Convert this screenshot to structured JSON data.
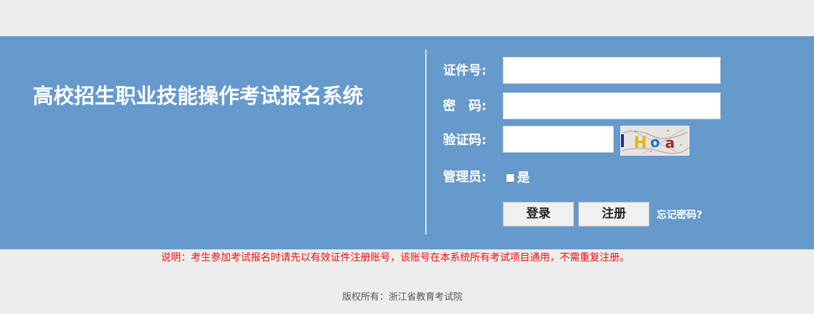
{
  "header": {
    "title": "高校招生职业技能操作考试报名系统"
  },
  "login_form": {
    "id_label": "证件号:",
    "id_value": "",
    "password_label": "密　码:",
    "password_value": "",
    "captcha_label": "验证码:",
    "captcha_value": "",
    "captcha_image_text": "lHoa",
    "admin_label": "管理员:",
    "admin_option_label": "是",
    "admin_checked": false,
    "login_button": "登录",
    "register_button": "注册",
    "forgot_password_link": "忘记密码?"
  },
  "notice": "说明：考生参加考试报名时请先以有效证件注册账号，该账号在本系统所有考试项目通用，不需重复注册。",
  "footer": {
    "copyright": "版权所有：浙江省教育考试院"
  },
  "colors": {
    "page_background": "#ededed",
    "banner_background": "#6699cc",
    "notice_text": "#ee1111",
    "footer_text": "#555555"
  }
}
